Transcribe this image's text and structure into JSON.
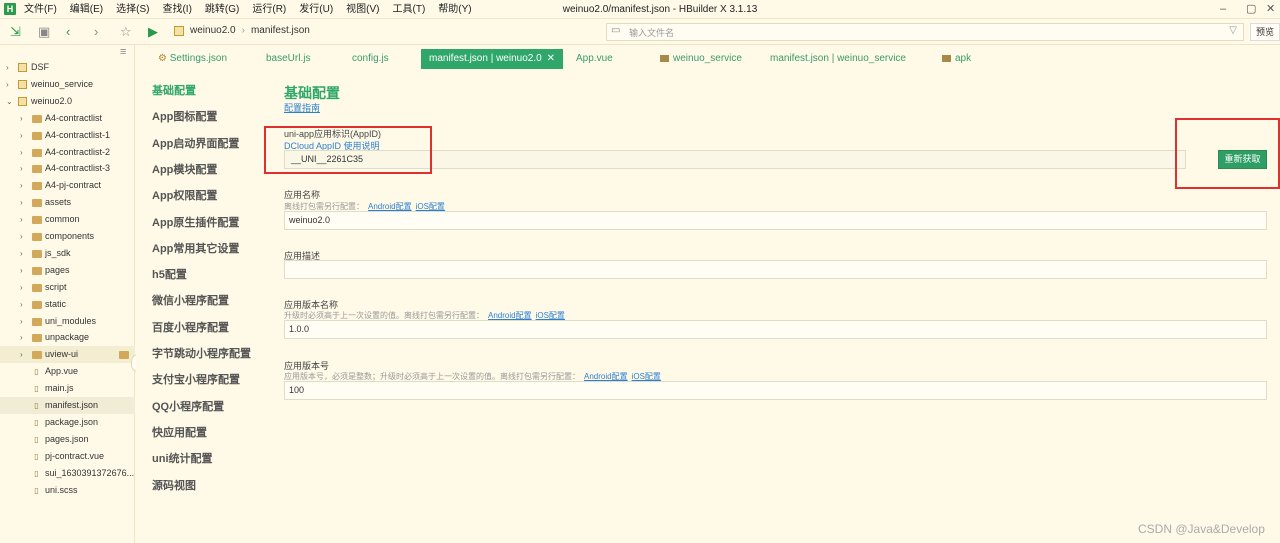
{
  "window": {
    "title": "weinuo2.0/manifest.json - HBuilder X 3.1.13",
    "logo": "H",
    "minimize": "–",
    "restore": "▢",
    "close": "✕"
  },
  "menu": [
    "文件(F)",
    "编辑(E)",
    "选择(S)",
    "查找(I)",
    "跳转(G)",
    "运行(R)",
    "发行(U)",
    "视图(V)",
    "工具(T)",
    "帮助(Y)"
  ],
  "toolbar": {
    "breadcrumb": [
      "weinuo2.0",
      "manifest.json"
    ],
    "search_placeholder": "输入文件名",
    "preview_label": "预览"
  },
  "sidebar": {
    "items": [
      {
        "label": "DSF",
        "type": "project",
        "level": 0,
        "arrow": "›"
      },
      {
        "label": "weinuo_service",
        "type": "project",
        "level": 0,
        "arrow": "›"
      },
      {
        "label": "weinuo2.0",
        "type": "project",
        "level": 0,
        "arrow": "⌄"
      },
      {
        "label": "A4-contractlist",
        "type": "folder",
        "level": 1,
        "arrow": "›"
      },
      {
        "label": "A4-contractlist-1",
        "type": "folder",
        "level": 1,
        "arrow": "›"
      },
      {
        "label": "A4-contractlist-2",
        "type": "folder",
        "level": 1,
        "arrow": "›"
      },
      {
        "label": "A4-contractlist-3",
        "type": "folder",
        "level": 1,
        "arrow": "›"
      },
      {
        "label": "A4-pj-contract",
        "type": "folder",
        "level": 1,
        "arrow": "›"
      },
      {
        "label": "assets",
        "type": "folder",
        "level": 1,
        "arrow": "›"
      },
      {
        "label": "common",
        "type": "folder",
        "level": 1,
        "arrow": "›"
      },
      {
        "label": "components",
        "type": "folder",
        "level": 1,
        "arrow": "›"
      },
      {
        "label": "js_sdk",
        "type": "folder",
        "level": 1,
        "arrow": "›"
      },
      {
        "label": "pages",
        "type": "folder",
        "level": 1,
        "arrow": "›"
      },
      {
        "label": "script",
        "type": "folder",
        "level": 1,
        "arrow": "›"
      },
      {
        "label": "static",
        "type": "folder",
        "level": 1,
        "arrow": "›"
      },
      {
        "label": "uni_modules",
        "type": "folder",
        "level": 1,
        "arrow": "›"
      },
      {
        "label": "unpackage",
        "type": "folder",
        "level": 1,
        "arrow": "›"
      },
      {
        "label": "uview-ui",
        "type": "folder",
        "level": 1,
        "arrow": "›"
      },
      {
        "label": "App.vue",
        "type": "file",
        "level": 1,
        "arrow": ""
      },
      {
        "label": "main.js",
        "type": "file",
        "level": 1,
        "arrow": ""
      },
      {
        "label": "manifest.json",
        "type": "file",
        "level": 1,
        "arrow": "",
        "selected": true
      },
      {
        "label": "package.json",
        "type": "file",
        "level": 1,
        "arrow": ""
      },
      {
        "label": "pages.json",
        "type": "file",
        "level": 1,
        "arrow": ""
      },
      {
        "label": "pj-contract.vue",
        "type": "file",
        "level": 1,
        "arrow": ""
      },
      {
        "label": "sui_1630391372676...",
        "type": "file",
        "level": 1,
        "arrow": ""
      },
      {
        "label": "uni.scss",
        "type": "file",
        "level": 1,
        "arrow": ""
      }
    ]
  },
  "tabs": [
    {
      "label": "Settings.json",
      "icon": "gear-icon"
    },
    {
      "label": "baseUrl.js"
    },
    {
      "label": "config.js"
    },
    {
      "label": "manifest.json | weinuo2.0",
      "active": true,
      "close": "✕"
    },
    {
      "label": "App.vue"
    },
    {
      "label": "weinuo_service",
      "icon": "folder-icon"
    },
    {
      "label": "manifest.json | weinuo_service"
    },
    {
      "label": "apk",
      "icon": "folder-icon"
    }
  ],
  "settings_nav": [
    "基础配置",
    "App图标配置",
    "App启动界面配置",
    "App模块配置",
    "App权限配置",
    "App原生插件配置",
    "App常用其它设置",
    "h5配置",
    "微信小程序配置",
    "百度小程序配置",
    "字节跳动小程序配置",
    "支付宝小程序配置",
    "QQ小程序配置",
    "快应用配置",
    "uni统计配置",
    "源码视图"
  ],
  "content": {
    "heading": "基础配置",
    "guide_link": "配置指南",
    "appid": {
      "label": "uni-app应用标识(AppID)",
      "help_link": "DCloud AppID 使用说明",
      "value": "__UNI__2261C35",
      "refetch_button": "重新获取"
    },
    "app_name": {
      "label": "应用名称",
      "hint": "离线打包需另行配置：",
      "android_link": "Android配置",
      "ios_link": "iOS配置",
      "value": "weinuo2.0"
    },
    "app_desc": {
      "label": "应用描述",
      "value": ""
    },
    "version_name": {
      "label": "应用版本名称",
      "hint": "升级时必须高于上一次设置的值。离线打包需另行配置：",
      "android_link": "Android配置",
      "ios_link": "iOS配置",
      "value": "1.0.0"
    },
    "version_code": {
      "label": "应用版本号",
      "hint": "应用版本号，必须是整数；升级时必须高于上一次设置的值。离线打包需另行配置：",
      "android_link": "Android配置",
      "ios_link": "iOS配置",
      "value": "100"
    }
  },
  "watermark": "CSDN @Java&Develop",
  "colors": {
    "accent": "#2fa66a",
    "background": "#fffae8",
    "link": "#2b7fd2",
    "highlight_box": "#e02f2f"
  }
}
